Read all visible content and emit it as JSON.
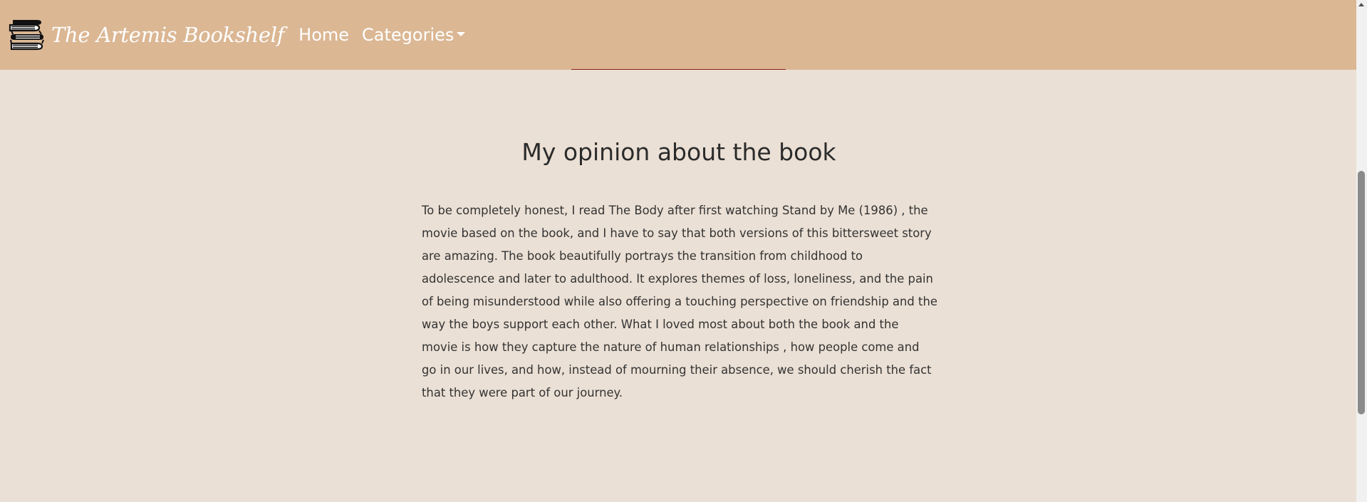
{
  "navbar": {
    "brand_icon": "book-stack-icon",
    "brand_text": "The Artemis Bookshelf",
    "home_label": "Home",
    "categories_label": "Categories",
    "background_color": "#dbb794",
    "text_color": "#ffffff"
  },
  "main": {
    "title": "My opinion about the book",
    "paragraph": "To be completely honest, I read The Body after first watching Stand by Me (1986) , the movie based on the book, and I have to say that both versions of this bittersweet story are amazing. The book beautifully portrays the transition from childhood to adolescence and later to adulthood. It explores themes of loss, loneliness, and the pain of being misunderstood while also offering a touching perspective on friendship and the way the boys support each other. What I loved most about both the book and the movie is how they capture the nature of human relationships , how people come and go in our lives, and how, instead of mourning their absence, we should cherish the fact that they were part of our journey.",
    "background_color": "#ebe0d5",
    "accent_color": "#8b1a1a"
  }
}
